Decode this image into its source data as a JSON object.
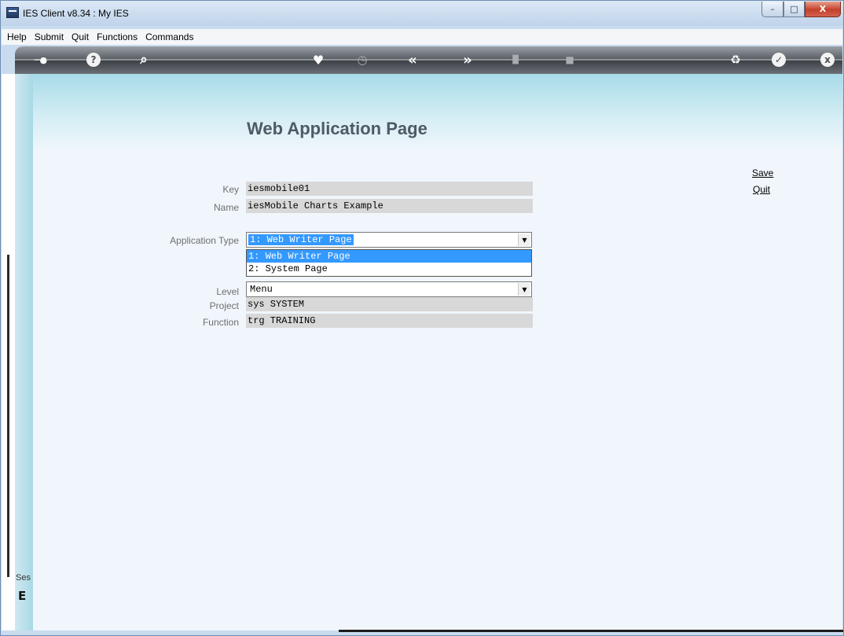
{
  "window": {
    "title": "IES Client v8.34 : My IES",
    "min_glyph": "–",
    "max_glyph": "□",
    "close_glyph": "X"
  },
  "menubar": {
    "items": [
      "Help",
      "Submit",
      "Quit",
      "Functions",
      "Commands"
    ]
  },
  "toolbar": {
    "icons": [
      {
        "name": "key-icon",
        "glyph": "─●"
      },
      {
        "name": "help-icon",
        "glyph": "?"
      },
      {
        "name": "search-icon",
        "glyph": "⌕"
      },
      {
        "name": "heart-icon",
        "glyph": "♥"
      },
      {
        "name": "clock-icon",
        "glyph": "◷"
      },
      {
        "name": "rewind-icon",
        "glyph": "«"
      },
      {
        "name": "forward-icon",
        "glyph": "»"
      },
      {
        "name": "tools-icon",
        "glyph": "▐▌"
      },
      {
        "name": "square-icon",
        "glyph": "■"
      },
      {
        "name": "recycle-icon",
        "glyph": "♻"
      },
      {
        "name": "check-icon",
        "glyph": "✓"
      },
      {
        "name": "close-circle-icon",
        "glyph": "x"
      }
    ]
  },
  "sidebar": {
    "session_label": "Ses",
    "glyph": "E"
  },
  "page": {
    "title": "Web Application Page",
    "save_link": "Save",
    "quit_link": "Quit"
  },
  "form": {
    "key_label": "Key",
    "key_value": "iesmobile01",
    "name_label": "Name",
    "name_value": "iesMobile Charts Example",
    "app_type_label": "Application Type",
    "app_type_value": "1: Web Writer Page",
    "app_type_options": [
      "1: Web Writer Page",
      "2: System Page"
    ],
    "level_label": "Level",
    "level_value": "Menu",
    "project_label": "Project",
    "project_value": "sys SYSTEM",
    "function_label": "Function",
    "function_value": "trg TRAINING"
  },
  "colors": {
    "selection": "#3399ff",
    "field_bg": "#d8d8d8",
    "header_gradient_top": "#a7dbe8"
  }
}
